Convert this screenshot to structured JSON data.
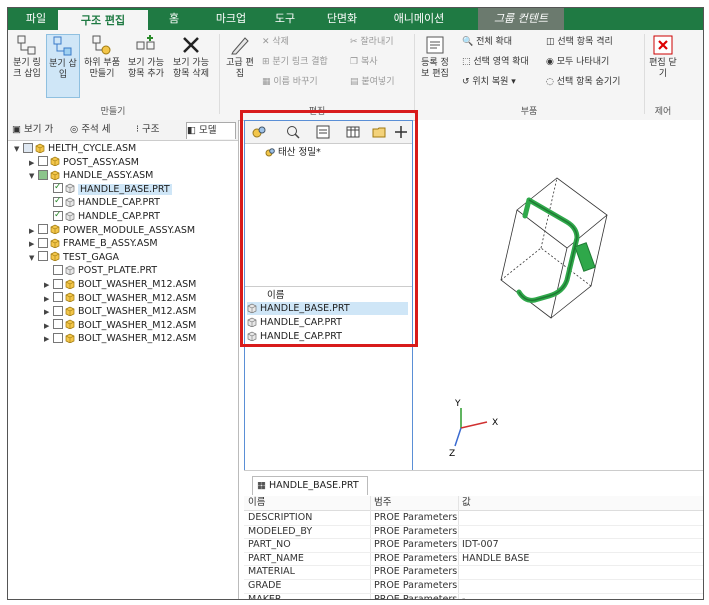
{
  "menu": {
    "tabs": [
      "파일",
      "구조 편집",
      "홈",
      "마크업",
      "도구",
      "단면화",
      "애니메이션",
      "그룹 컨텐트"
    ]
  },
  "ribbon": {
    "buttons": {
      "branch_link": "분기 링\n크 삽입",
      "branch_insert": "분기 삽\n입",
      "sub_part": "하위 부품\n만들기",
      "add_branch_item": "보기 가능\n항목 추가",
      "delete_branch_item": "보기 가능\n항목 삭제",
      "advanced_edit": "고급 편\n집",
      "register_edit": "등록 정\n보 편집",
      "close_edit": "편집 닫\n기"
    },
    "small": {
      "delete": "삭제",
      "cut": "잘라내기",
      "branch_link_combine": "분기 링크 결합",
      "copy": "복사",
      "rename": "이름 바꾸기",
      "paste": "붙여넣기",
      "expand_all": "전체 확대",
      "select_isolate": "선택 항목 격리",
      "select_area_expand": "선택 영역 확대",
      "show_all": "모두 나타내기",
      "restore_position": "위치 복원",
      "hide_selected": "선택 항목 숨기기"
    },
    "groups": {
      "create": "만들기",
      "edit": "편집",
      "parts": "부품",
      "remove": "제어"
    }
  },
  "left_panel": {
    "tabs": [
      "보기 가",
      "주석 세",
      "구조",
      "모델"
    ],
    "tree": [
      {
        "label": "HELTH_CYCLE.ASM",
        "depth": 0,
        "arrow": "down",
        "check": "none",
        "type": "asm"
      },
      {
        "label": "POST_ASSY.ASM",
        "depth": 1,
        "arrow": "right",
        "check": "off",
        "type": "asm"
      },
      {
        "label": "HANDLE_ASSY.ASM",
        "depth": 1,
        "arrow": "down",
        "check": "partial",
        "type": "asm"
      },
      {
        "label": "HANDLE_BASE.PRT",
        "depth": 2,
        "arrow": "",
        "check": "on",
        "type": "prt",
        "highlight": true
      },
      {
        "label": "HANDLE_CAP.PRT",
        "depth": 2,
        "arrow": "",
        "check": "on",
        "type": "prt"
      },
      {
        "label": "HANDLE_CAP.PRT",
        "depth": 2,
        "arrow": "",
        "check": "on",
        "type": "prt"
      },
      {
        "label": "POWER_MODULE_ASSY.ASM",
        "depth": 1,
        "arrow": "right",
        "check": "off",
        "type": "asm"
      },
      {
        "label": "FRAME_B_ASSY.ASM",
        "depth": 1,
        "arrow": "right",
        "check": "off",
        "type": "asm"
      },
      {
        "label": "TEST_GAGA",
        "depth": 1,
        "arrow": "down",
        "check": "off",
        "type": "asm"
      },
      {
        "label": "POST_PLATE.PRT",
        "depth": 2,
        "arrow": "",
        "check": "off",
        "type": "prt"
      },
      {
        "label": "BOLT_WASHER_M12.ASM",
        "depth": 2,
        "arrow": "right",
        "check": "off",
        "type": "asm"
      },
      {
        "label": "BOLT_WASHER_M12.ASM",
        "depth": 2,
        "arrow": "right",
        "check": "off",
        "type": "asm"
      },
      {
        "label": "BOLT_WASHER_M12.ASM",
        "depth": 2,
        "arrow": "right",
        "check": "off",
        "type": "asm"
      },
      {
        "label": "BOLT_WASHER_M12.ASM",
        "depth": 2,
        "arrow": "right",
        "check": "off",
        "type": "asm"
      },
      {
        "label": "BOLT_WASHER_M12.ASM",
        "depth": 2,
        "arrow": "right",
        "check": "off",
        "type": "asm"
      }
    ]
  },
  "mid_panel": {
    "node_label": "태산 정밀*",
    "list_header": "이름",
    "items": [
      "HANDLE_BASE.PRT",
      "HANDLE_CAP.PRT",
      "HANDLE_CAP.PRT"
    ]
  },
  "viewport": {
    "axis_x": "X",
    "axis_y": "Y",
    "axis_z": "Z"
  },
  "params": {
    "tab_label": "HANDLE_BASE.PRT",
    "headers": [
      "이름",
      "범주",
      "값"
    ],
    "rows": [
      [
        "DESCRIPTION",
        "PROE Parameters",
        ""
      ],
      [
        "MODELED_BY",
        "PROE Parameters",
        ""
      ],
      [
        "PART_NO",
        "PROE Parameters",
        "IDT-007"
      ],
      [
        "PART_NAME",
        "PROE Parameters",
        "HANDLE BASE"
      ],
      [
        "MATERIAL",
        "PROE Parameters",
        ""
      ],
      [
        "GRADE",
        "PROE Parameters",
        ""
      ],
      [
        "MAKER",
        "PROE Parameters",
        "-"
      ]
    ]
  },
  "colors": {
    "menu_green": "#1f7a43",
    "highlight_blue": "#cfe6f7",
    "callout_red": "#d81b1b",
    "model_green": "#2fa84a"
  }
}
